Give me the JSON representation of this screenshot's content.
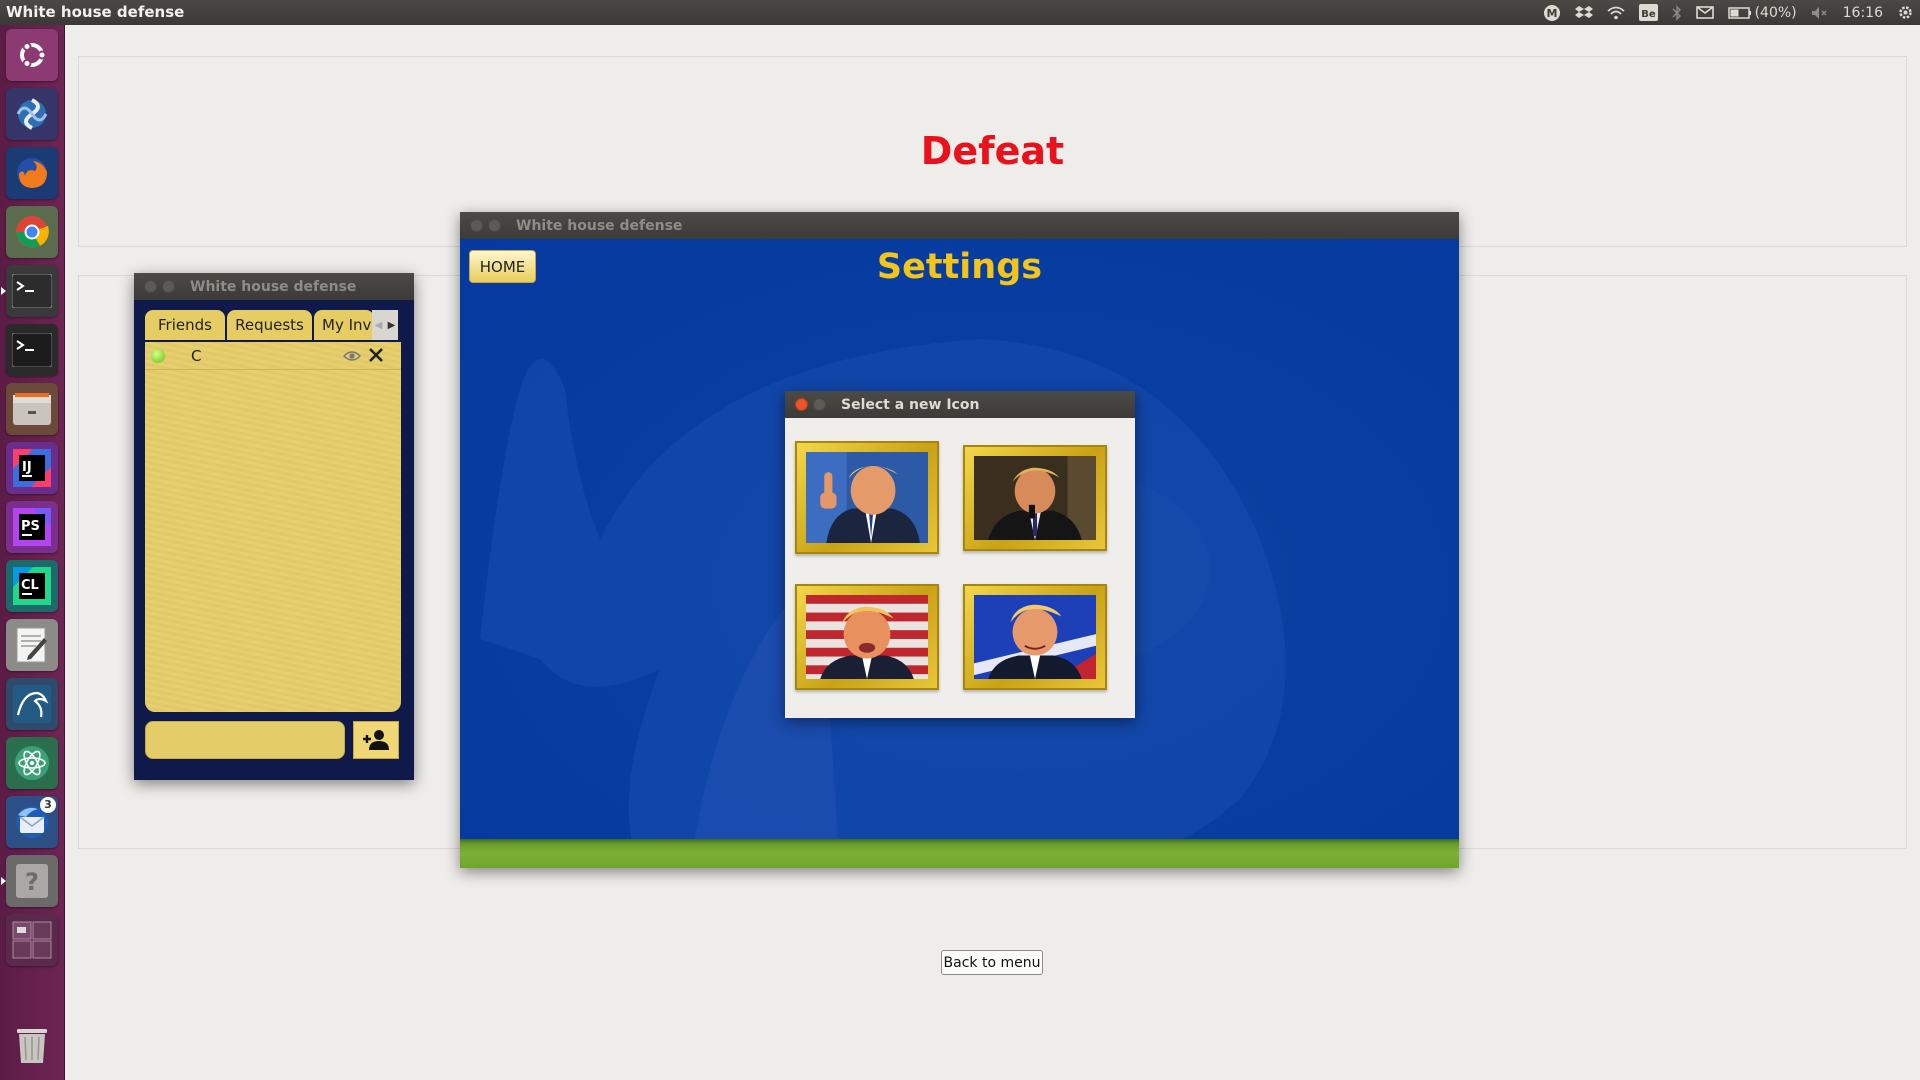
{
  "topbar": {
    "title": "White house defense",
    "battery": "(40%)",
    "time": "16:16"
  },
  "launcher": {
    "items": [
      "ubuntu-icon",
      "gimp-swirl-icon",
      "firefox-icon",
      "chrome-icon",
      "terminal-icon",
      "terminal-icon",
      "files-icon",
      "intellij-icon",
      "phpstorm-icon",
      "clion-icon",
      "text-editor-icon",
      "mysql-workbench-icon",
      "atom-icon",
      "thunderbird-icon",
      "help-icon",
      "workspace-switcher-icon",
      "trash-icon"
    ],
    "thunderbird_badge": "3"
  },
  "main": {
    "result_title": "Defeat",
    "back_to_menu": "Back to menu"
  },
  "friends_window": {
    "title": "White house defense",
    "tabs": [
      "Friends",
      "Requests",
      "My Inv"
    ],
    "friends": [
      {
        "name": "C",
        "status": "online"
      }
    ],
    "message_input_value": ""
  },
  "settings_window": {
    "title": "White house defense",
    "home_label": "HOME",
    "heading": "Settings"
  },
  "icon_dialog": {
    "title": "Select a new Icon",
    "options": [
      "trump-portrait-1",
      "trump-portrait-2",
      "trump-portrait-3",
      "trump-portrait-4"
    ]
  },
  "colors": {
    "defeat": "#e8111c",
    "settings_heading": "#f3c51a",
    "settings_bg": "#0539a0",
    "launcher": "#5e1d4a",
    "gold": "#e6cd63"
  }
}
